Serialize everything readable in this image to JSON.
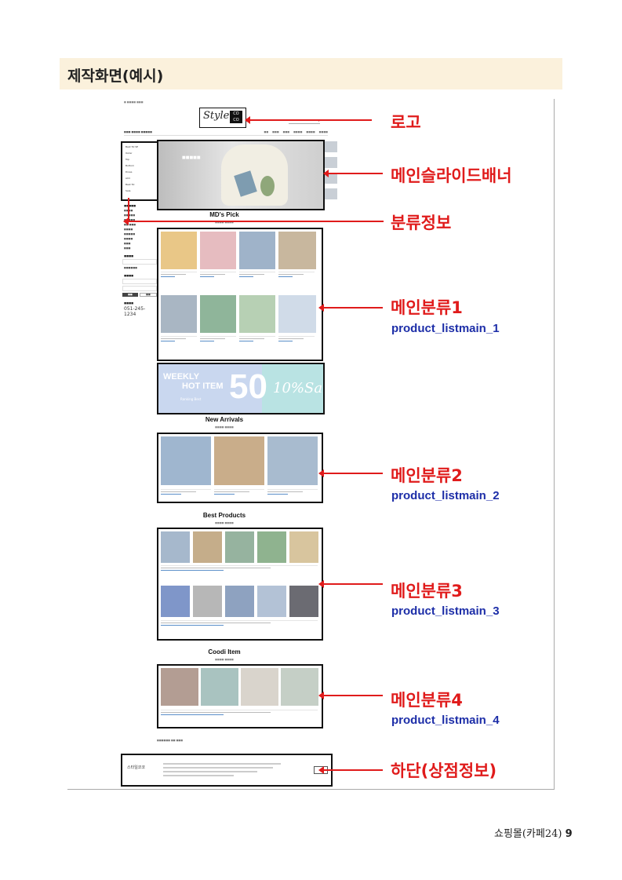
{
  "header": {
    "title": "제작화면(예시)"
  },
  "shop": {
    "logo_text": "Style",
    "section_titles": [
      "MD's Pick",
      "New Arrivals",
      "Best Products",
      "Coodi Item"
    ],
    "category_items": [
      "Best 50 SE",
      "Outer",
      "Top",
      "Bottom",
      "Dress",
      "ACC",
      "Best 50",
      "Sale"
    ],
    "phone": "051-245-1234",
    "weekly": {
      "line1": "WEEKLY",
      "line2": "HOT ITEM",
      "big": "50",
      "sale": "10%Sale",
      "ranking": "Ranking Best"
    },
    "footer_brand": "스타일코코"
  },
  "annotations": [
    {
      "label": "로고"
    },
    {
      "label": "메인슬라이드배너"
    },
    {
      "label": "분류정보"
    },
    {
      "label": "메인분류1",
      "sub": "product_listmain_1"
    },
    {
      "label": "메인분류2",
      "sub": "product_listmain_2"
    },
    {
      "label": "메인분류3",
      "sub": "product_listmain_3"
    },
    {
      "label": "메인분류4",
      "sub": "product_listmain_4"
    },
    {
      "label": "하단(상점정보)"
    }
  ],
  "page_number": {
    "text": "쇼핑몰(카페24)",
    "num": "9"
  }
}
